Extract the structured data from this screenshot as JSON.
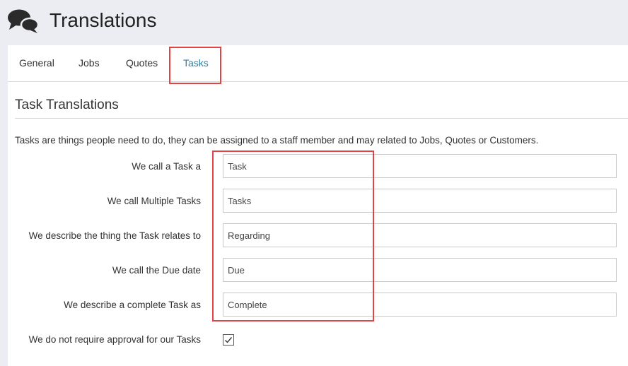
{
  "header": {
    "title": "Translations",
    "icon": "chat-bubbles-icon"
  },
  "tabs": [
    {
      "label": "General"
    },
    {
      "label": "Jobs"
    },
    {
      "label": "Quotes"
    },
    {
      "label": "Tasks",
      "active": true
    }
  ],
  "section": {
    "title": "Task Translations",
    "description": "Tasks are things people need to do, they can be assigned to a staff member and may related to Jobs, Quotes or Customers."
  },
  "fields": [
    {
      "label": "We call a Task a",
      "value": "Task"
    },
    {
      "label": "We call Multiple Tasks",
      "value": "Tasks"
    },
    {
      "label": "We describe the thing the Task relates to",
      "value": "Regarding"
    },
    {
      "label": "We call the Due date",
      "value": "Due"
    },
    {
      "label": "We describe a complete Task as",
      "value": "Complete"
    }
  ],
  "approval": {
    "label": "We do not require approval for our Tasks",
    "checked": true
  },
  "colors": {
    "accent": "#2e7fa3",
    "highlight": "#e24446",
    "background": "#ebedf2"
  }
}
